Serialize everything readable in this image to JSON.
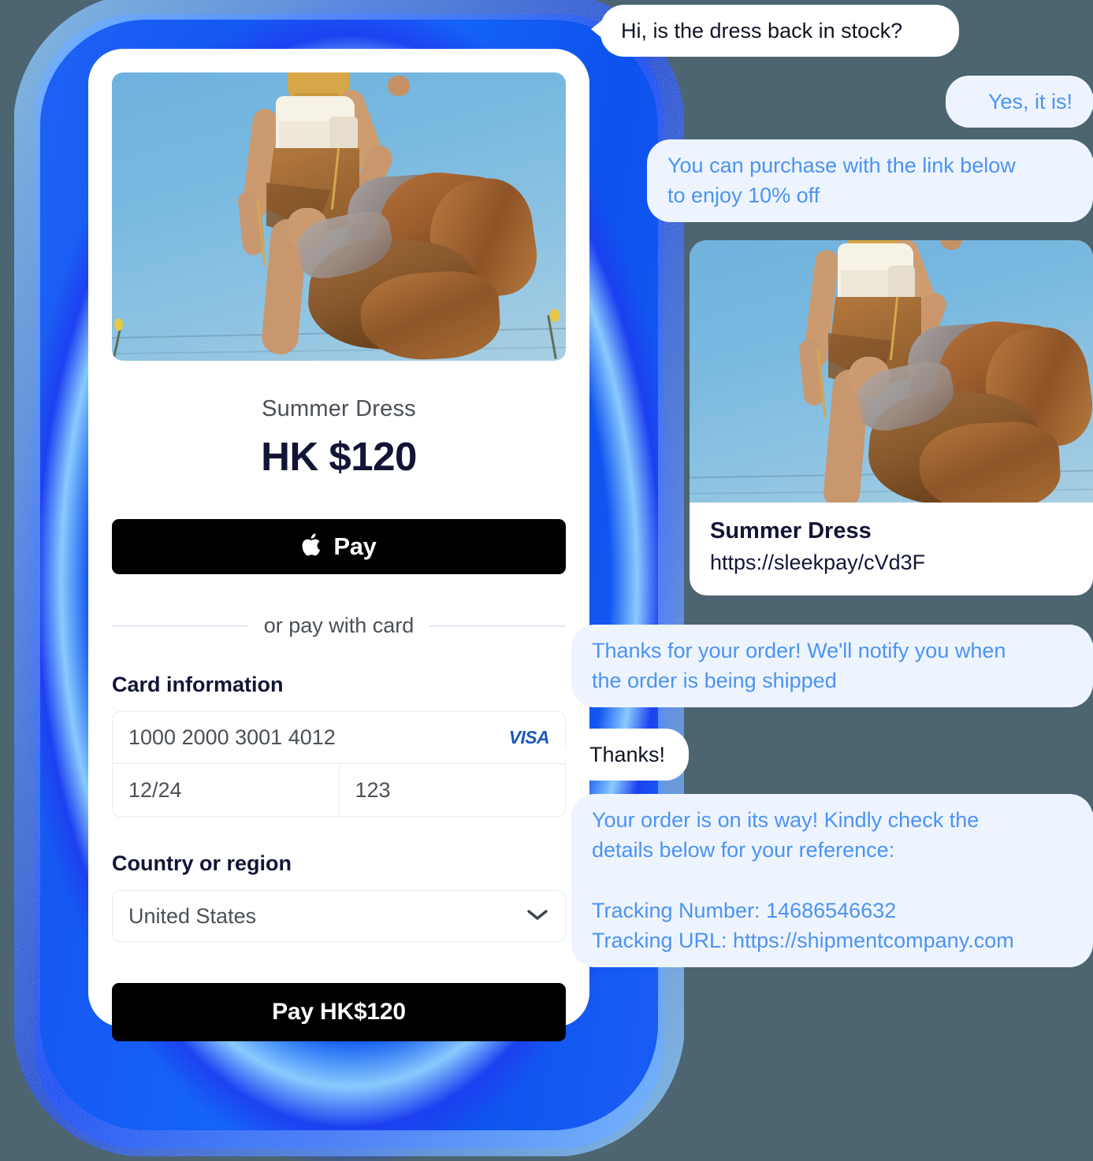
{
  "theme": {
    "background": "#4c6570",
    "phone_glow_blue": "#1558f2",
    "bubble_incoming_bg": "#ffffff",
    "bubble_incoming_text": "#111426",
    "bubble_outgoing_bg": "#eef4fd",
    "bubble_outgoing_text": "#4b93f5",
    "card_bg": "#ffffff",
    "button_black": "#000000",
    "visa_blue": "#1a5bb8",
    "heading_navy": "#121536",
    "body_gray": "#4a4f58",
    "input_border": "#e6ebf5"
  },
  "checkout": {
    "product_photo_alt": "Woman in white top and flowing rust colored summer dress against blue sky",
    "product_title": "Summer Dress",
    "price": "HK $120",
    "apple_pay": {
      "icon": "apple-logo-icon",
      "label": "Pay"
    },
    "divider_text": "or pay with card",
    "card_information": {
      "label": "Card information",
      "number": "1000 2000 3001 4012",
      "brand": "VISA",
      "expiry": "12/24",
      "cvc": "123"
    },
    "country": {
      "label": "Country or region",
      "value": "United States",
      "chevron": "chevron-down-icon"
    },
    "pay_button_label": "Pay HK$120"
  },
  "chat": {
    "messages": [
      {
        "id": "m1",
        "direction": "incoming",
        "text": "Hi, is the dress back in stock?"
      },
      {
        "id": "m2",
        "direction": "outgoing",
        "text": "Yes, it is!"
      },
      {
        "id": "m3",
        "direction": "outgoing",
        "text": "You can purchase with the link below\nto enjoy 10% off"
      },
      {
        "id": "m4",
        "direction": "outgoing",
        "text": "Thanks for your order! We'll notify you when\nthe order is being shipped"
      },
      {
        "id": "m5",
        "direction": "incoming",
        "text": "Thanks!"
      },
      {
        "id": "m6",
        "direction": "outgoing",
        "text": "Your order is on its way! Kindly check the\ndetails below for your reference:\n\nTracking Number: 14686546632\nTracking URL: https://shipmentcompany.com"
      }
    ],
    "link_card": {
      "photo_alt": "Woman in white top and flowing rust colored summer dress against blue sky",
      "title": "Summer Dress",
      "url": "https://sleekpay/cVd3F"
    }
  }
}
